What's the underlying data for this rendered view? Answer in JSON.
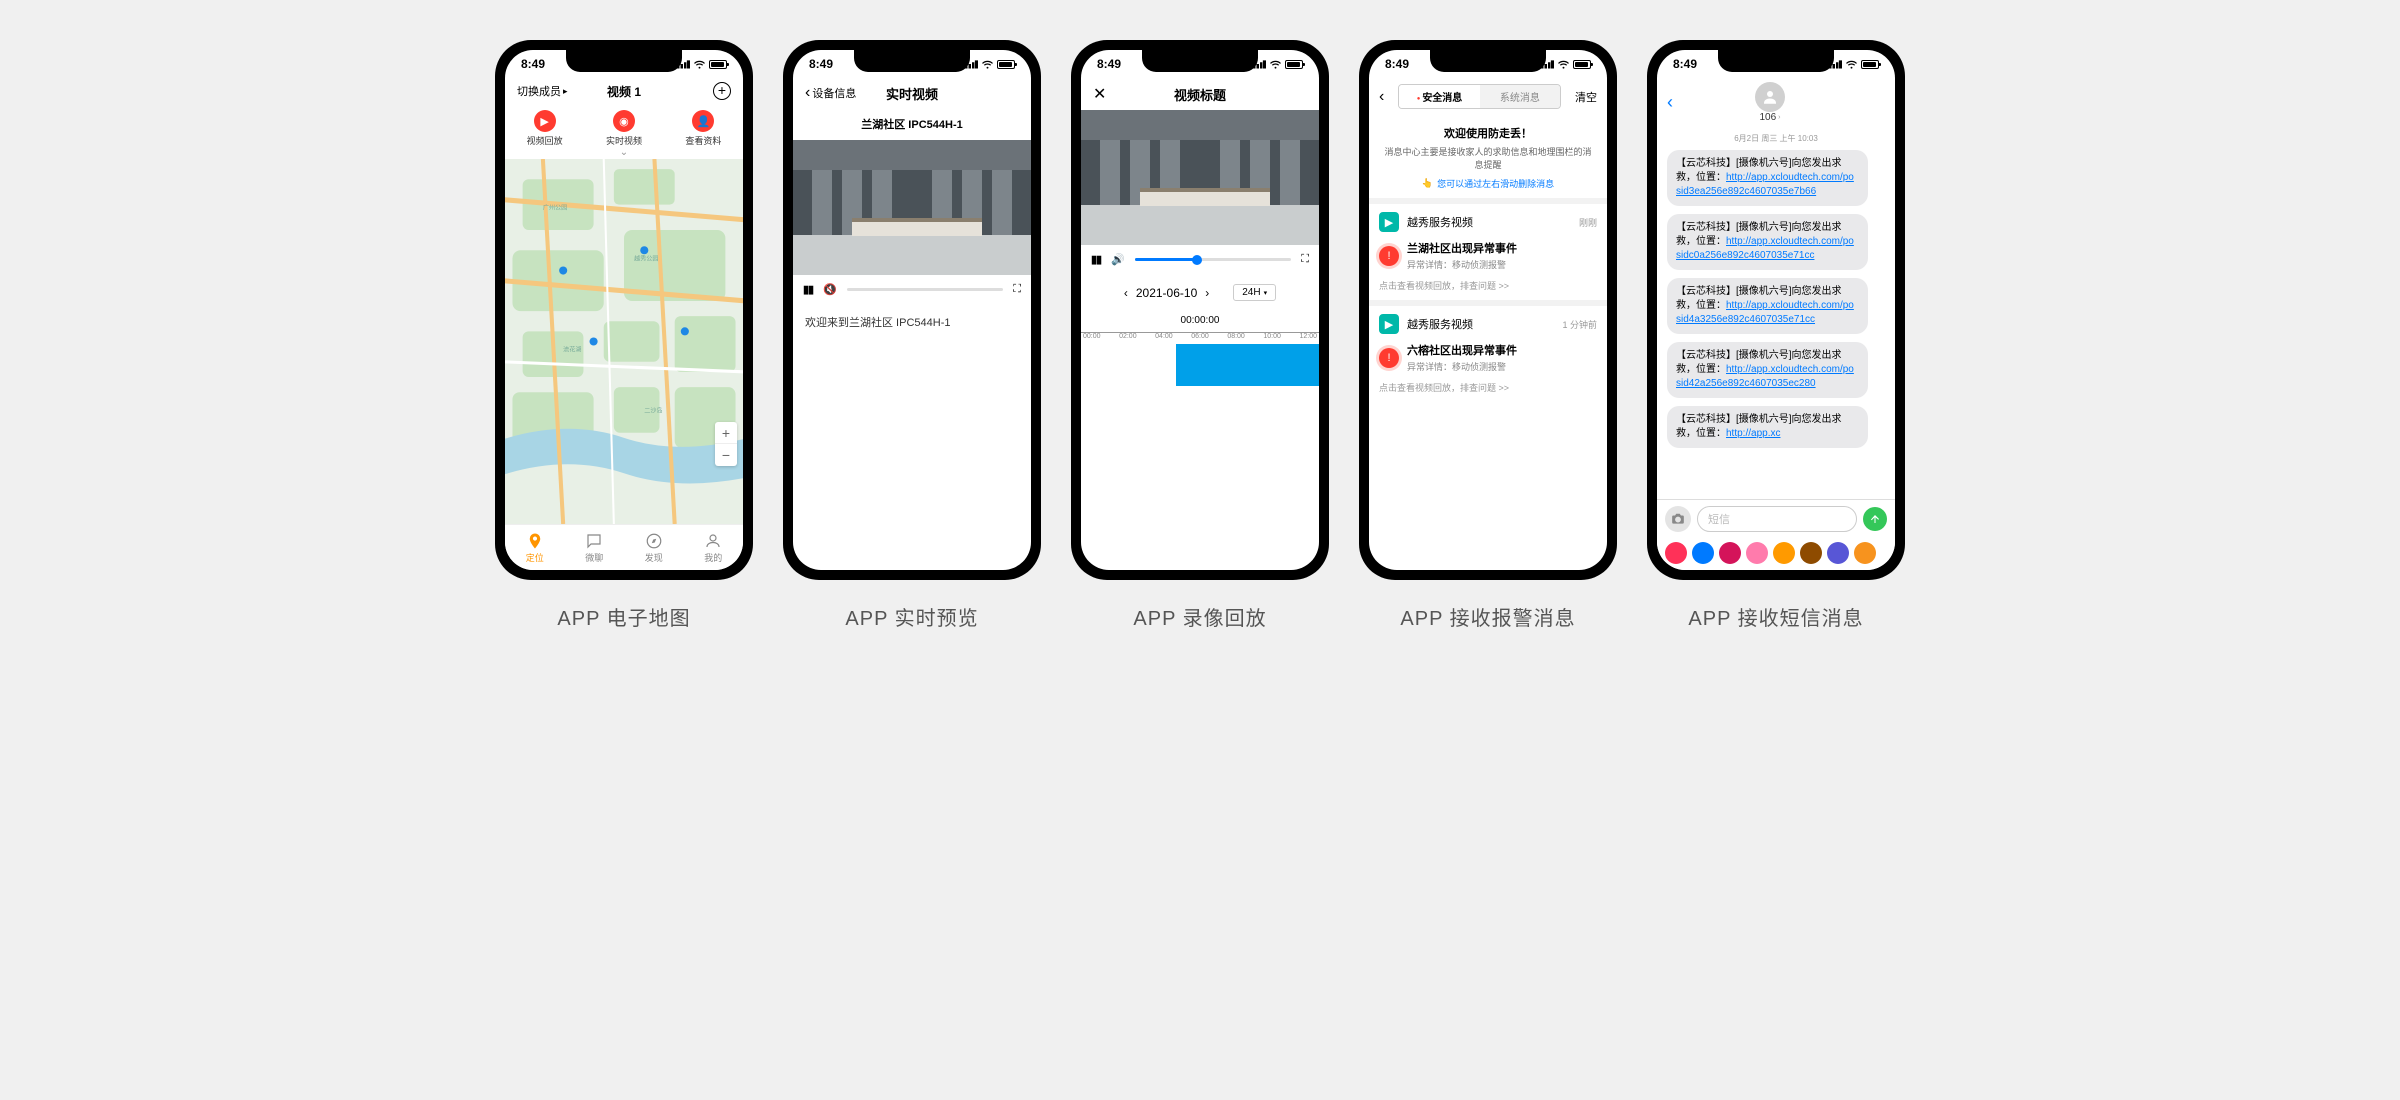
{
  "status_time": "8:49",
  "captions": [
    "APP 电子地图",
    "APP 实时预览",
    "APP 录像回放",
    "APP 接收报警消息",
    "APP 接收短信消息"
  ],
  "phone1": {
    "switch_member": "切换成员",
    "title": "视频 1",
    "quick": [
      {
        "icon_name": "playback-icon",
        "label": "视频回放"
      },
      {
        "icon_name": "live-icon",
        "label": "实时视频"
      },
      {
        "icon_name": "profile-icon",
        "label": "查看资料"
      }
    ],
    "tabs": [
      {
        "label": "定位",
        "active": true
      },
      {
        "label": "微聊",
        "active": false
      },
      {
        "label": "发现",
        "active": false
      },
      {
        "label": "我的",
        "active": false
      }
    ]
  },
  "phone2": {
    "back": "设备信息",
    "title": "实时视频",
    "subtitle": "兰湖社区 IPC544H-1",
    "welcome": "欢迎来到兰湖社区 IPC544H-1"
  },
  "phone3": {
    "title": "视频标题",
    "date": "2021-06-10",
    "range": "24H",
    "timecode": "00:00:00",
    "ticks": [
      "00:00",
      "02:00",
      "04:00",
      "06:00",
      "08:00",
      "10:00",
      "12:00"
    ]
  },
  "phone4": {
    "seg": [
      "安全消息",
      "系统消息"
    ],
    "clear": "清空",
    "welcome_title": "欢迎使用防走丢！",
    "welcome_sub": "消息中心主要是接收家人的求助信息和地理围栏的消息提醒",
    "welcome_tip": "您可以通过左右滑动删除消息",
    "cards": [
      {
        "title": "越秀服务视频",
        "time": "刚刚",
        "event": "兰湖社区出现异常事件",
        "detail_label": "异常详情：",
        "detail": "移动侦测报警",
        "link": "点击查看视频回放，排查问题 >>"
      },
      {
        "title": "越秀服务视频",
        "time": "1 分钟前",
        "event": "六榕社区出现异常事件",
        "detail_label": "异常详情：",
        "detail": "移动侦测报警",
        "link": "点击查看视频回放，排查问题 >>"
      }
    ]
  },
  "phone5": {
    "contact": "106",
    "timestamp": "6月2日 周三 上午 10:03",
    "msg_prefix": "【云芯科技】[摄像机六号]向您发出求救，位置：",
    "msg_link_base": "http://app.xcloudtech.com/",
    "messages": [
      "posid3ea256e892c4607035e7b66",
      "posidc0a256e892c4607035e71cc",
      "posid4a3256e892c4607035e71cc",
      "posid42a256e892c4607035ec280"
    ],
    "msg_truncated_link": "http://app.xc",
    "input_placeholder": "短信",
    "app_colors": [
      "#ff3158",
      "#007aff",
      "#d4145a",
      "#ff7bac",
      "#ff9a00",
      "#8e4b00",
      "#5856d6",
      "#f7931e"
    ]
  }
}
